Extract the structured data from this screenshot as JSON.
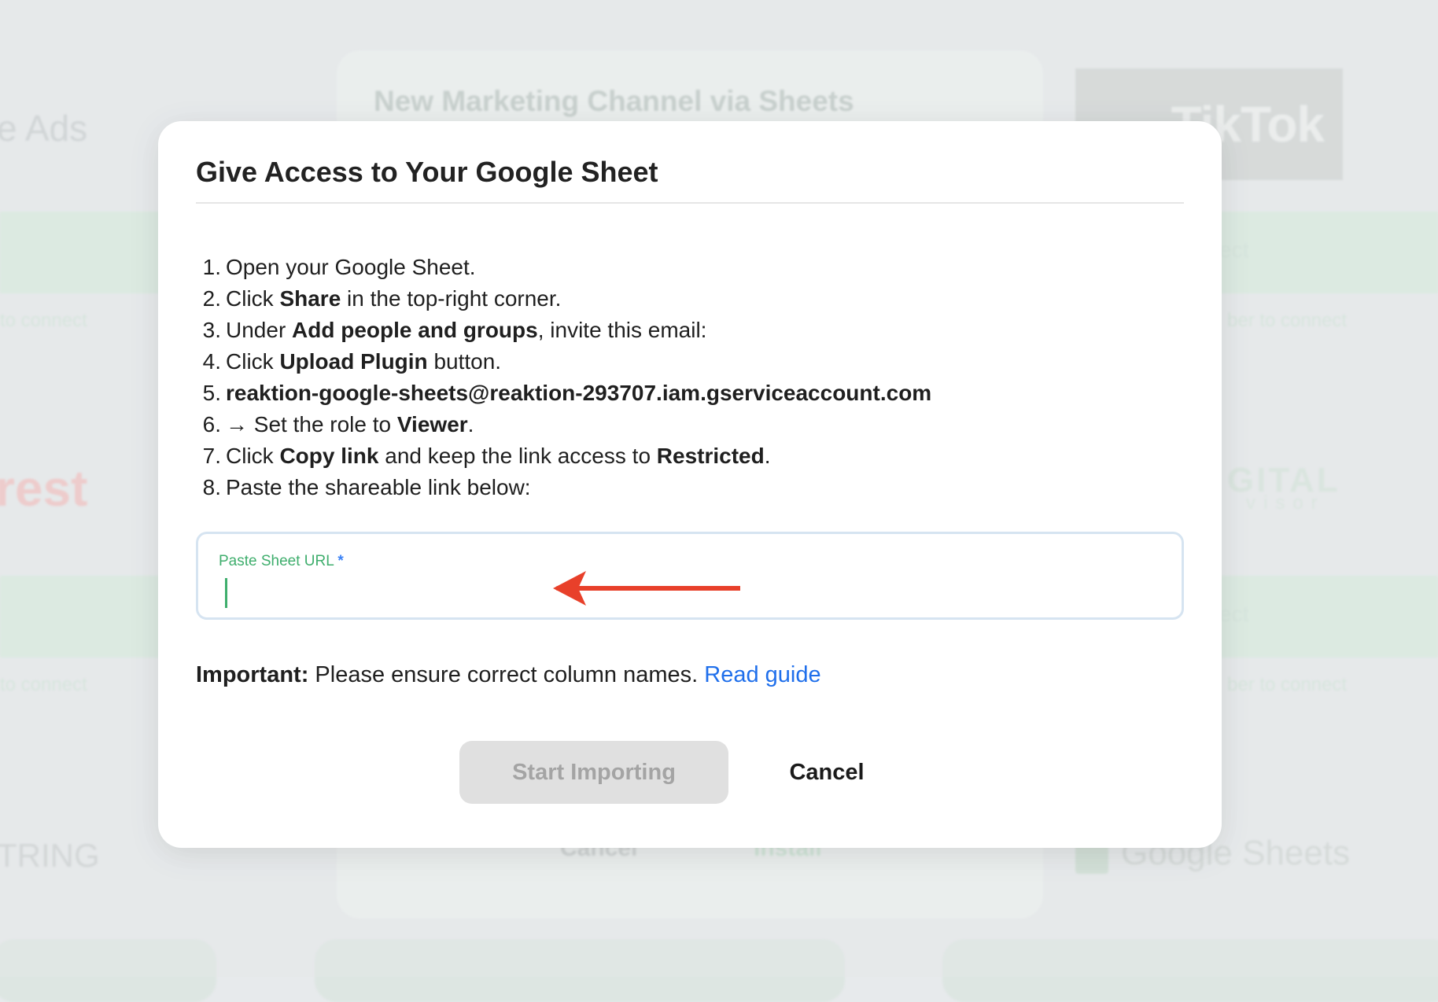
{
  "background": {
    "card_title": "New Marketing Channel via Sheets",
    "left_brand_1": "e Ads",
    "left_band_text_1": "to connect",
    "left_brand_2": "rest",
    "left_band_text_2": "to connect",
    "left_brand_3": "TRING",
    "right_brand_1": "TikTok",
    "right_band_1": "ect",
    "right_sub_1": "ber to connect",
    "right_brand_2_line1": "GITAL",
    "right_brand_2_line2": "visor",
    "right_band_2": "ect",
    "right_sub_2": "ber to connect",
    "right_brand_3": "Google Sheets",
    "card_cancel": "Cancel",
    "card_install": "Install"
  },
  "modal": {
    "title": "Give Access to Your Google Sheet",
    "steps": [
      {
        "num": "1.",
        "text": "Open your Google Sheet."
      },
      {
        "num": "2.",
        "pre": "Click ",
        "bold": "Share",
        "post": " in the top-right corner."
      },
      {
        "num": "3.",
        "pre": "Under ",
        "bold": "Add people and groups",
        "post": ", invite this email:"
      },
      {
        "num": "4.",
        "pre": "Click ",
        "bold": "Upload Plugin",
        "post": " button."
      },
      {
        "num": "5.",
        "bold": "reaktion-google-sheets@reaktion-293707.iam.gserviceaccount.com"
      },
      {
        "num": "6.",
        "pre": "→ Set the role to ",
        "bold": "Viewer",
        "post": "."
      },
      {
        "num": "7.",
        "pre": "Click ",
        "bold": "Copy link",
        "mid": " and keep the link access to ",
        "bold2": "Restricted",
        "post": "."
      },
      {
        "num": "8.",
        "text": "Paste the shareable link below:"
      }
    ],
    "url_field": {
      "label": "Paste Sheet URL",
      "required_mark": "*",
      "value": ""
    },
    "important": {
      "label": "Important:",
      "text": " Please ensure correct column names. ",
      "link": "Read guide"
    },
    "start_button": "Start Importing",
    "cancel_button": "Cancel"
  },
  "colors": {
    "accent_green": "#3fae6d",
    "link_blue": "#1f6feb",
    "annotation_red": "#e8402a",
    "disabled_button": "#e0e0e0"
  }
}
